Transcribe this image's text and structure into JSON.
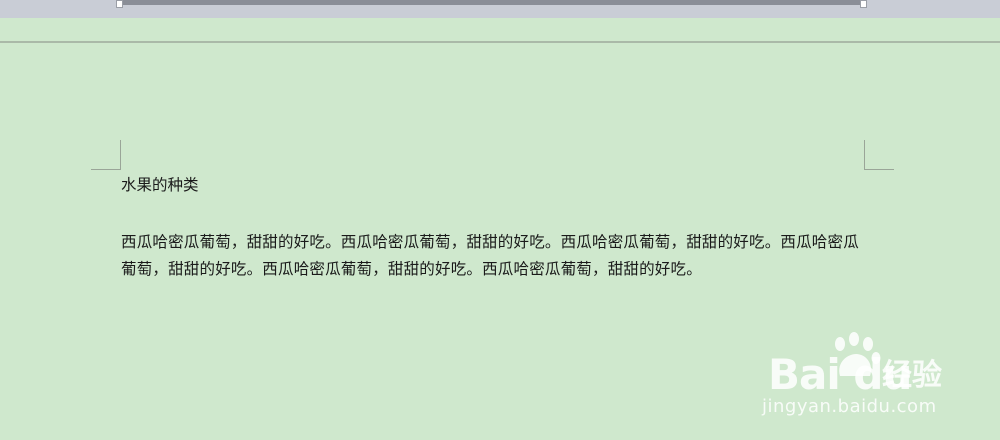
{
  "document": {
    "title": "水果的种类",
    "paragraph": "西瓜哈密瓜葡萄，甜甜的好吃。西瓜哈密瓜葡萄，甜甜的好吃。西瓜哈密瓜葡萄，甜甜的好吃。西瓜哈密瓜葡萄，甜甜的好吃。西瓜哈密瓜葡萄，甜甜的好吃。西瓜哈密瓜葡萄，甜甜的好吃。"
  },
  "watermark": {
    "brand": "Bai du",
    "product": "经验",
    "url": "jingyan.baidu.com"
  },
  "colors": {
    "page_background": "#cfe8cd",
    "text": "#1a1a1a",
    "ruler": "#8a8e97"
  }
}
